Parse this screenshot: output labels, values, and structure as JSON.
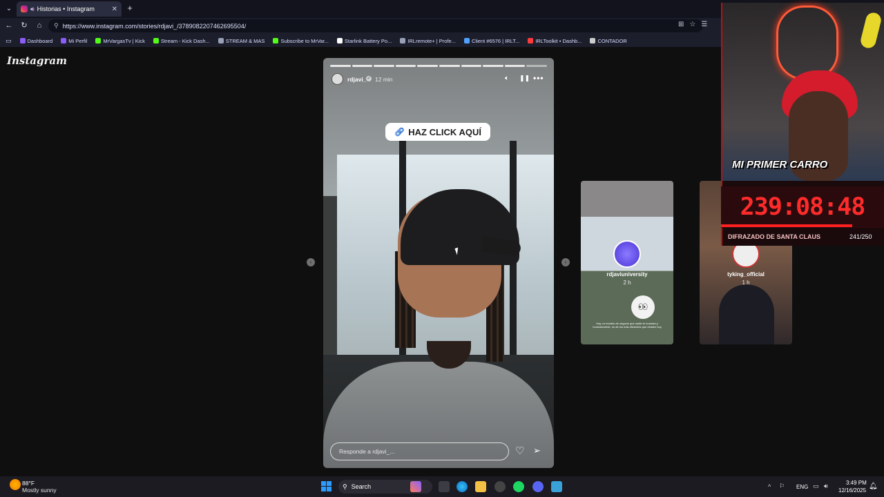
{
  "browser": {
    "tab_title": "Historias • Instagram",
    "url": "https://www.instagram.com/stories/rdjavi_/3789082207462695504/",
    "bookmarks": [
      {
        "label": "Dashboard",
        "color": "#8b5cf6"
      },
      {
        "label": "Mi Perfil",
        "color": "#8b5cf6"
      },
      {
        "label": "MrVargasTv | Kick",
        "color": "#53fc18"
      },
      {
        "label": "Stream - Kick Dash...",
        "color": "#53fc18"
      },
      {
        "label": "STREAM & MAS",
        "color": "#9aa0b5"
      },
      {
        "label": "Subscribe to MrVar...",
        "color": "#53fc18"
      },
      {
        "label": "Starlink Battery Po...",
        "color": "#ffffff"
      },
      {
        "label": "IRLremote+ | Profe...",
        "color": "#9aa0b5"
      },
      {
        "label": "Client #6576 | IRLT...",
        "color": "#4fa3ff"
      },
      {
        "label": "IRLToolkit • Dashb...",
        "color": "#ff3b3b"
      },
      {
        "label": "CONTADOR",
        "color": "#cccccc"
      }
    ]
  },
  "instagram": {
    "logo": "Instagram",
    "story": {
      "username": "rdjavi_",
      "time": "12 min",
      "sticker": "HAZ CLICK AQUÍ",
      "reply_placeholder": "Responde a rdjavi_..."
    },
    "next_stories": [
      {
        "username": "rdjaviuniversity",
        "time": "2 h",
        "caption": "Hay un modelo de negocio que nadie te muestra y honestamente, es de los más eficientes que existen hoy"
      },
      {
        "username": "tyking_official",
        "time": "1 h"
      }
    ]
  },
  "stream_overlay": {
    "banner": "MI PRIMER CARRO",
    "timer": "239:08:48",
    "goal_label": "DIFRAZADO DE SANTA CLAUS",
    "goal_count": "241/250"
  },
  "taskbar": {
    "temperature": "88°F",
    "weather": "Mostly sunny",
    "search": "Search",
    "language": "ENG",
    "time": "3:49 PM",
    "date": "12/16/2025"
  }
}
